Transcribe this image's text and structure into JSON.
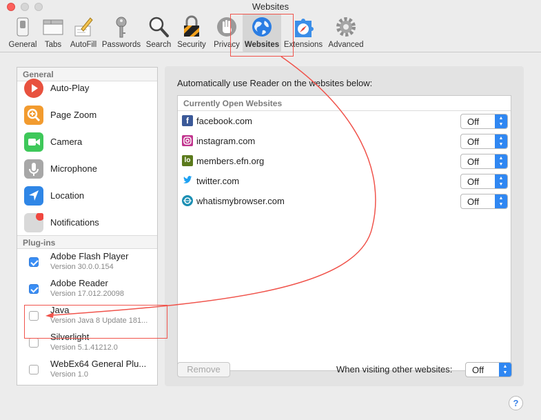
{
  "window": {
    "title": "Websites"
  },
  "toolbar": {
    "items": [
      {
        "label": "General",
        "icon": "general-switch-icon"
      },
      {
        "label": "Tabs",
        "icon": "tabs-icon"
      },
      {
        "label": "AutoFill",
        "icon": "autofill-pencil-icon"
      },
      {
        "label": "Passwords",
        "icon": "key-icon"
      },
      {
        "label": "Search",
        "icon": "magnifier-icon"
      },
      {
        "label": "Security",
        "icon": "padlock-icon"
      },
      {
        "label": "Privacy",
        "icon": "hand-icon"
      },
      {
        "label": "Websites",
        "icon": "globe-icon",
        "active": true
      },
      {
        "label": "Extensions",
        "icon": "puzzle-compass-icon"
      },
      {
        "label": "Advanced",
        "icon": "gear-icon"
      }
    ]
  },
  "sidebar": {
    "general_header": "General",
    "general_items": [
      {
        "label": "Auto-Play",
        "icon": "play-icon",
        "color": "#e8523f"
      },
      {
        "label": "Page Zoom",
        "icon": "zoom-icon",
        "color": "#f29b2f"
      },
      {
        "label": "Camera",
        "icon": "camera-icon",
        "color": "#3ec85a"
      },
      {
        "label": "Microphone",
        "icon": "microphone-icon",
        "color": "#a7a7a7"
      },
      {
        "label": "Location",
        "icon": "location-arrow-icon",
        "color": "#2f86e6"
      },
      {
        "label": "Notifications",
        "icon": "notifications-icon",
        "color": "#d9d9d9"
      }
    ],
    "plugins_header": "Plug-ins",
    "plugins": [
      {
        "name": "Adobe Flash Player",
        "version": "Version 30.0.0.154",
        "checked": true
      },
      {
        "name": "Adobe Reader",
        "version": "Version 17.012.20098",
        "checked": true
      },
      {
        "name": "Java",
        "version": "Version Java 8 Update 181...",
        "checked": false
      },
      {
        "name": "Silverlight",
        "version": "Version 5.1.41212.0",
        "checked": false
      },
      {
        "name": "WebEx64 General Plu...",
        "version": "Version 1.0",
        "checked": false
      }
    ]
  },
  "main": {
    "description": "Automatically use Reader on the websites below:",
    "list_header": "Currently Open Websites",
    "sites": [
      {
        "name": "facebook.com",
        "value": "Off",
        "icon": "facebook-icon",
        "color": "#3b5998"
      },
      {
        "name": "instagram.com",
        "value": "Off",
        "icon": "instagram-icon",
        "color": "#c1358e"
      },
      {
        "name": "members.efn.org",
        "value": "Off",
        "icon": "efn-icon",
        "color": "#5b7a1c"
      },
      {
        "name": "twitter.com",
        "value": "Off",
        "icon": "twitter-icon",
        "color": "#1da1f2"
      },
      {
        "name": "whatismybrowser.com",
        "value": "Off",
        "icon": "whatismybrowser-icon",
        "color": "#1b8fb3"
      }
    ],
    "remove_label": "Remove",
    "other_label": "When visiting other websites:",
    "other_value": "Off"
  },
  "help_label": "?",
  "annotation_color": "#f0534b"
}
